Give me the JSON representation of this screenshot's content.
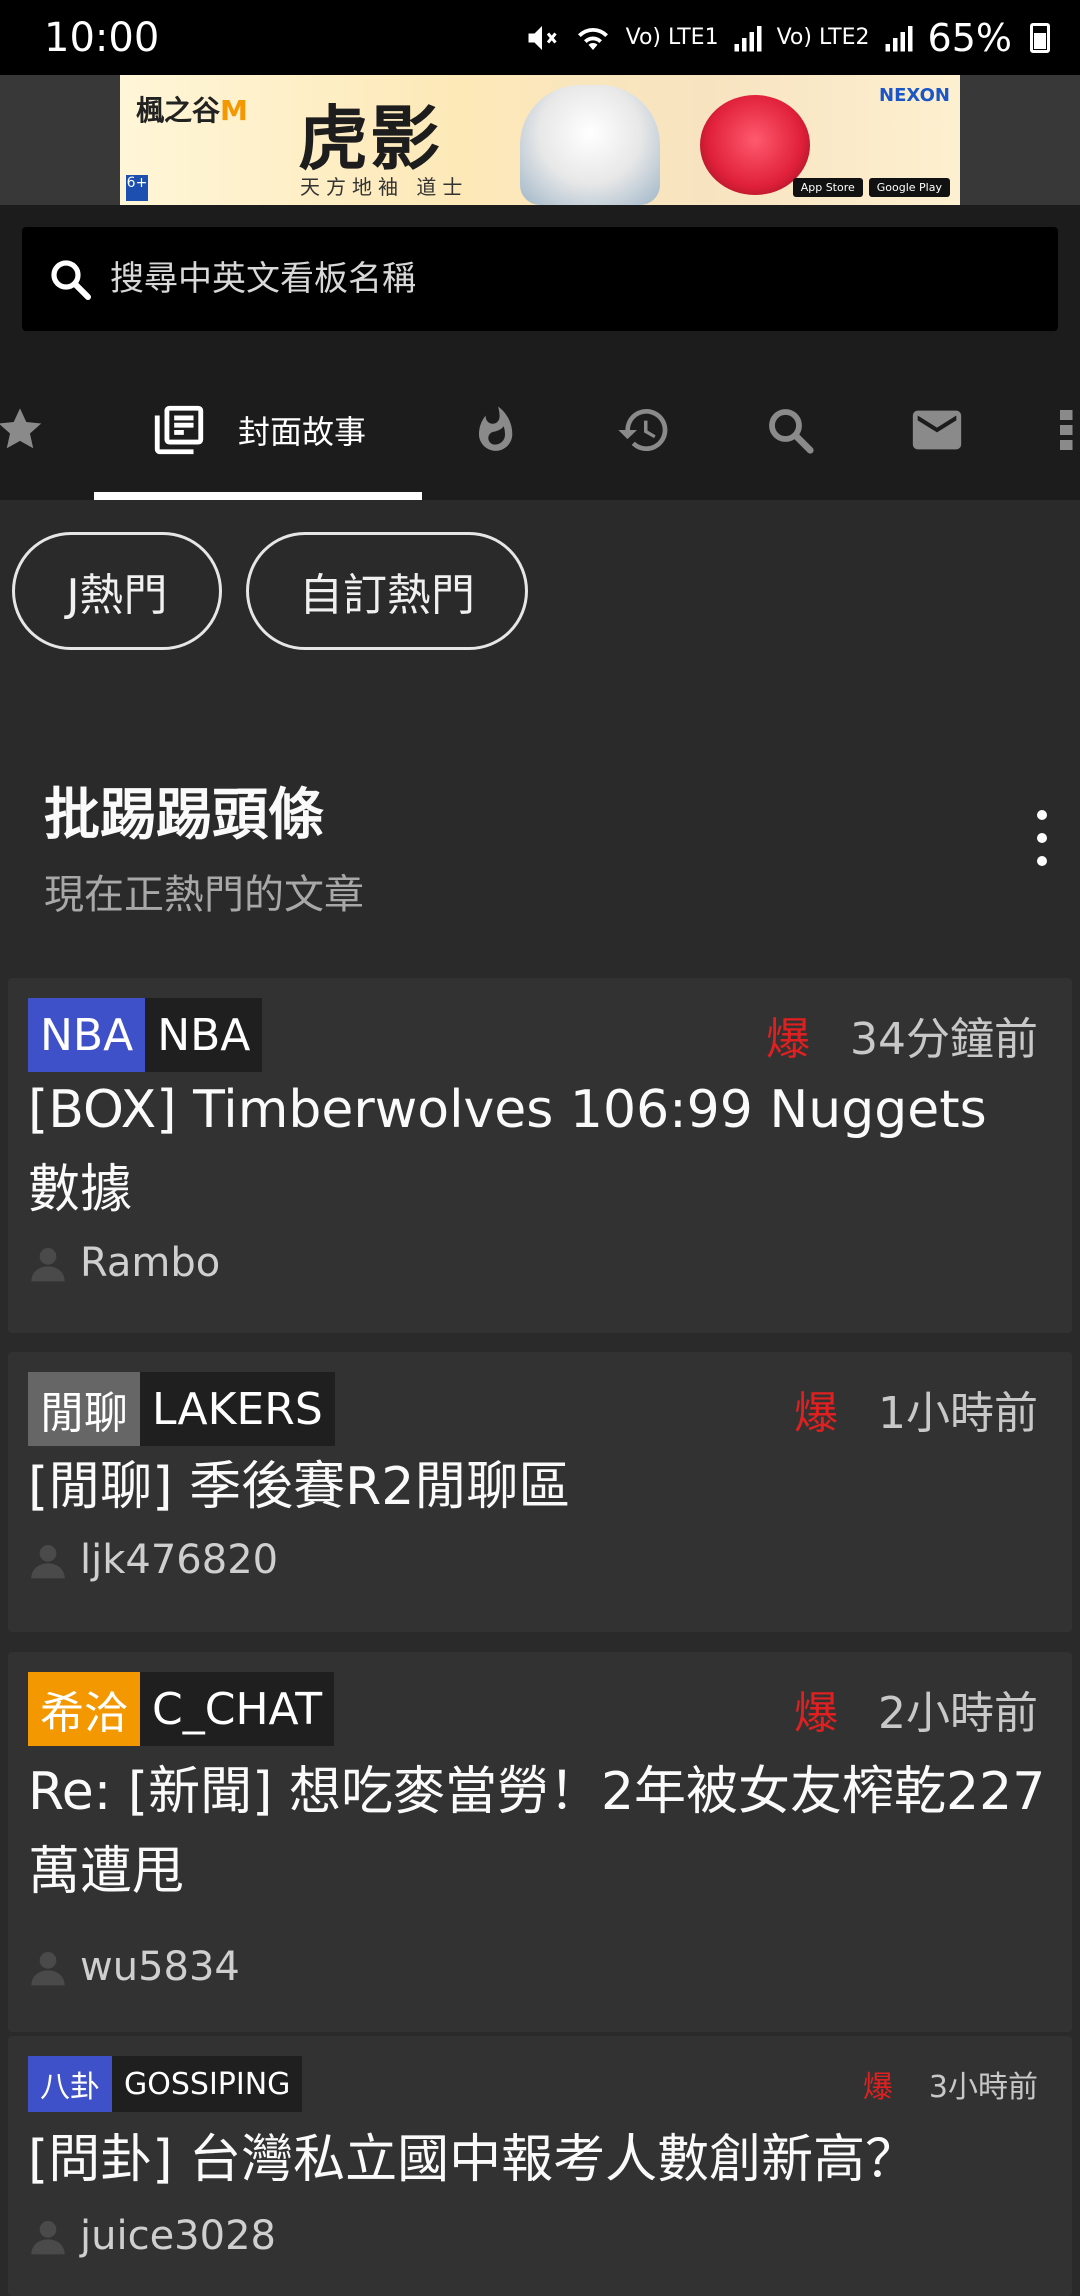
{
  "status_bar": {
    "time": "10:00",
    "net1": "Vo) LTE1",
    "net2": "Vo) LTE2",
    "battery": "65%"
  },
  "ad": {
    "logo_text": "楓之谷",
    "logo_m": "M",
    "title": "虎影",
    "subtitle": "天方地袖 道士",
    "brand": "NEXON",
    "age": "6+",
    "store1": "App Store",
    "store2": "Google Play"
  },
  "search": {
    "placeholder": "搜尋中英文看板名稱"
  },
  "tabs": {
    "active_label": "封面故事",
    "items": [
      "favorites",
      "cover-story",
      "hot",
      "history",
      "search",
      "mail",
      "more"
    ]
  },
  "chips": [
    "J熱門",
    "自訂熱門"
  ],
  "section": {
    "title": "批踢踢頭條",
    "subtitle": "現在正熱門的文章"
  },
  "colors": {
    "nba_badge": "#3f51c8",
    "chat_badge": "#666666",
    "cchat_badge": "#f39800",
    "gossip_badge": "#3f51c8",
    "hot": "#e02020"
  },
  "articles": [
    {
      "badge": "NBA",
      "board": "NBA",
      "hot": "爆",
      "time": "34分鐘前",
      "title": "[BOX] Timberwolves 106:99 Nuggets 數據",
      "author": "Rambo"
    },
    {
      "badge": "閒聊",
      "board": "LAKERS",
      "hot": "爆",
      "time": "1小時前",
      "title": "[閒聊] 季後賽R2閒聊區",
      "author": "ljk476820"
    },
    {
      "badge": "希洽",
      "board": "C_CHAT",
      "hot": "爆",
      "time": "2小時前",
      "title": "Re: [新聞] 想吃麥當勞！2年被女友榨乾227萬遭甩",
      "author": "wu5834"
    },
    {
      "badge": "八卦",
      "board": "GOSSIPING",
      "hot": "爆",
      "time": "3小時前",
      "title": "[問卦] 台灣私立國中報考人數創新高？",
      "author": "juice3028"
    }
  ]
}
